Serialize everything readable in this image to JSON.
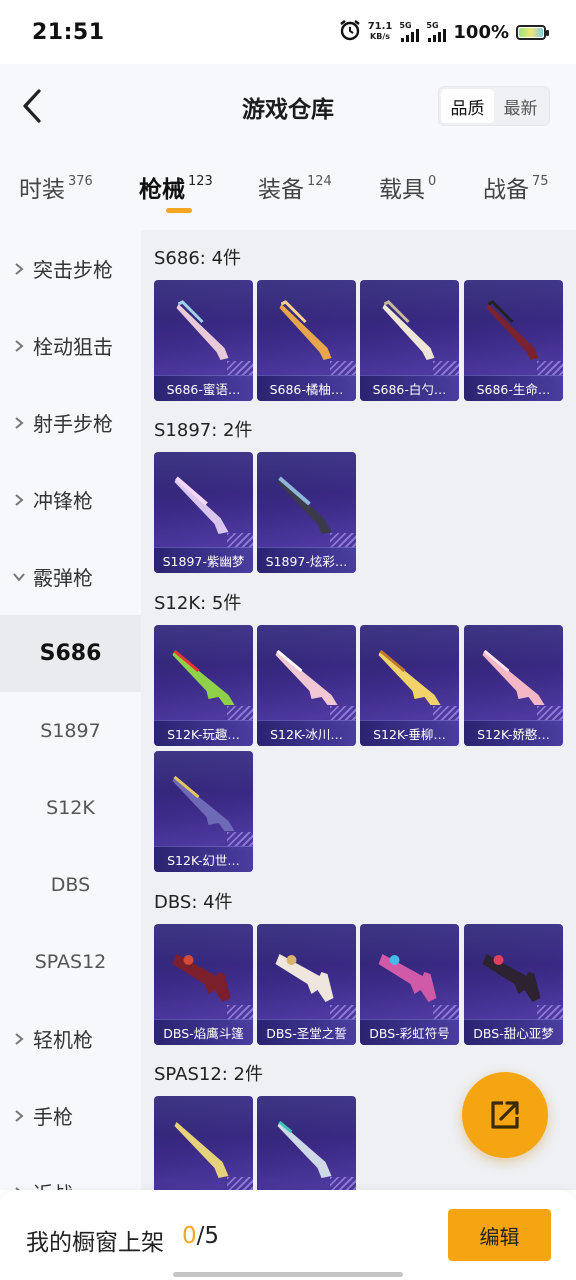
{
  "status_bar": {
    "time": "21:51",
    "net_speed_value": "71.1",
    "net_speed_unit": "KB/s",
    "sim1_label": "5G",
    "sim2_label": "5G",
    "battery": "100%",
    "alarm_icon": "alarm-clock-icon"
  },
  "header": {
    "title": "游戏仓库",
    "back_icon": "chevron-left-icon",
    "sort_options": [
      "品质",
      "最新"
    ],
    "sort_selected": "品质"
  },
  "tabs": [
    {
      "label": "时装",
      "count": "376"
    },
    {
      "label": "枪械",
      "count": "123",
      "active": true
    },
    {
      "label": "装备",
      "count": "124"
    },
    {
      "label": "载具",
      "count": "0"
    },
    {
      "label": "战备",
      "count": "75"
    }
  ],
  "sidebar": {
    "categories": [
      {
        "label": "突击步枪",
        "expanded": false
      },
      {
        "label": "栓动狙击",
        "expanded": false
      },
      {
        "label": "射手步枪",
        "expanded": false
      },
      {
        "label": "冲锋枪",
        "expanded": false
      },
      {
        "label": "霰弹枪",
        "expanded": true
      },
      {
        "label": "轻机枪",
        "expanded": false
      },
      {
        "label": "手枪",
        "expanded": false
      },
      {
        "label": "近战",
        "expanded": false
      }
    ],
    "subitems": [
      {
        "label": "S686",
        "active": true
      },
      {
        "label": "S1897"
      },
      {
        "label": "S12K"
      },
      {
        "label": "DBS"
      },
      {
        "label": "SPAS12"
      }
    ]
  },
  "groups": [
    {
      "title": "S686: 4件",
      "items": [
        "S686-蜜语…",
        "S686-橘柚…",
        "S686-白勺…",
        "S686-生命…"
      ]
    },
    {
      "title": "S1897: 2件",
      "items": [
        "S1897-紫幽梦",
        "S1897-炫彩…"
      ]
    },
    {
      "title": "S12K: 5件",
      "items": [
        "S12K-玩趣…",
        "S12K-冰川…",
        "S12K-垂柳…",
        "S12K-娇憨…",
        "S12K-幻世…"
      ]
    },
    {
      "title": "DBS: 4件",
      "items": [
        "DBS-焰鹰斗篷",
        "DBS-圣堂之誓",
        "DBS-彩虹符号",
        "DBS-甜心亚梦"
      ]
    },
    {
      "title": "SPAS12: 2件",
      "items": [
        "",
        ""
      ]
    }
  ],
  "fab": {
    "icon": "share-external-icon"
  },
  "bottom": {
    "shelf_label": "我的橱窗上架",
    "shelf_current": "0",
    "shelf_total": "/5",
    "edit_label": "编辑"
  },
  "colors": {
    "accent": "#f6a512",
    "card_bg": "#3b2a86",
    "content_bg": "#eef0f4"
  }
}
